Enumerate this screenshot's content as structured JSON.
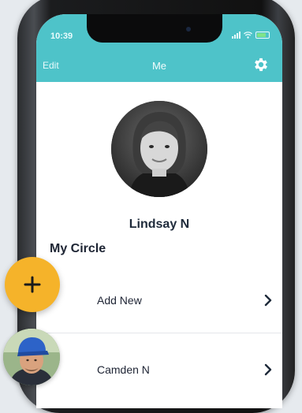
{
  "status_bar": {
    "time": "10:39"
  },
  "header": {
    "edit_label": "Edit",
    "title": "Me",
    "settings_icon": "gear-icon"
  },
  "profile": {
    "name": "Lindsay N"
  },
  "circle": {
    "section_title": "My Circle",
    "items": [
      {
        "label": "Add New",
        "icon": "plus-icon"
      },
      {
        "label": "Camden N",
        "icon": "avatar"
      }
    ]
  },
  "colors": {
    "header_bg": "#4ec3c9",
    "fab": "#f5b32a",
    "text_dark": "#1e2a3a"
  }
}
